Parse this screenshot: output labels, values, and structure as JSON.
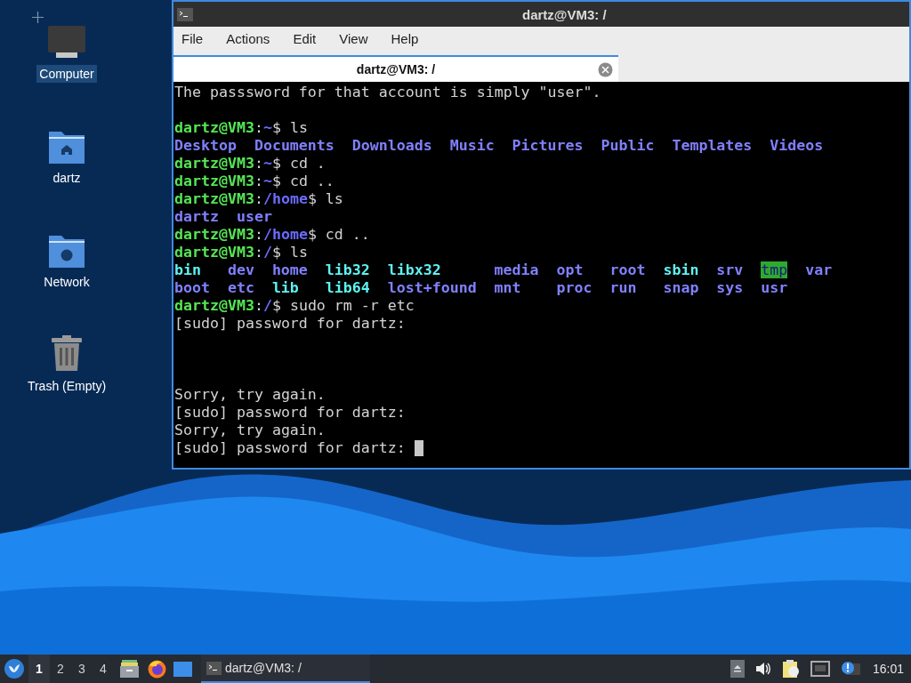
{
  "desktop_icons": [
    {
      "label": "Computer",
      "kind": "computer",
      "selected": true
    },
    {
      "label": "dartz",
      "kind": "home",
      "selected": false
    },
    {
      "label": "Network",
      "kind": "network",
      "selected": false
    },
    {
      "label": "Trash (Empty)",
      "kind": "trash",
      "selected": false
    }
  ],
  "window": {
    "title": "dartz@VM3: /",
    "menu": [
      "File",
      "Actions",
      "Edit",
      "View",
      "Help"
    ],
    "tabs": [
      {
        "label": "dartz@VM3: /",
        "selected": true
      }
    ],
    "terminal": {
      "lines": [
        {
          "kind": "text",
          "segments": [
            {
              "kind": "plain",
              "text": "The passsword for that account is simply \"user\"."
            }
          ]
        },
        {
          "kind": "blank"
        },
        {
          "kind": "text",
          "segments": [
            {
              "kind": "prompt",
              "text": "dartz@VM3"
            },
            {
              "kind": "plain",
              "text": ":"
            },
            {
              "kind": "path",
              "text": "~"
            },
            {
              "kind": "plain",
              "text": "$ ls"
            }
          ]
        },
        {
          "kind": "listing",
          "rows": [
            [
              {
                "kind": "dir",
                "text": "Desktop"
              },
              {
                "kind": "dir",
                "text": "Documents"
              },
              {
                "kind": "dir",
                "text": "Downloads"
              },
              {
                "kind": "dir",
                "text": "Music"
              },
              {
                "kind": "dir",
                "text": "Pictures"
              },
              {
                "kind": "dir",
                "text": "Public"
              },
              {
                "kind": "dir",
                "text": "Templates"
              },
              {
                "kind": "dir",
                "text": "Videos"
              }
            ]
          ]
        },
        {
          "kind": "text",
          "segments": [
            {
              "kind": "prompt",
              "text": "dartz@VM3"
            },
            {
              "kind": "plain",
              "text": ":"
            },
            {
              "kind": "path",
              "text": "~"
            },
            {
              "kind": "plain",
              "text": "$ cd ."
            }
          ]
        },
        {
          "kind": "text",
          "segments": [
            {
              "kind": "prompt",
              "text": "dartz@VM3"
            },
            {
              "kind": "plain",
              "text": ":"
            },
            {
              "kind": "path",
              "text": "~"
            },
            {
              "kind": "plain",
              "text": "$ cd .."
            }
          ]
        },
        {
          "kind": "text",
          "segments": [
            {
              "kind": "prompt",
              "text": "dartz@VM3"
            },
            {
              "kind": "plain",
              "text": ":"
            },
            {
              "kind": "path",
              "text": "/home"
            },
            {
              "kind": "plain",
              "text": "$ ls"
            }
          ]
        },
        {
          "kind": "listing",
          "rows": [
            [
              {
                "kind": "dir",
                "text": "dartz"
              },
              {
                "kind": "dir",
                "text": "user"
              }
            ]
          ]
        },
        {
          "kind": "text",
          "segments": [
            {
              "kind": "prompt",
              "text": "dartz@VM3"
            },
            {
              "kind": "plain",
              "text": ":"
            },
            {
              "kind": "path",
              "text": "/home"
            },
            {
              "kind": "plain",
              "text": "$ cd .."
            }
          ]
        },
        {
          "kind": "text",
          "segments": [
            {
              "kind": "prompt",
              "text": "dartz@VM3"
            },
            {
              "kind": "plain",
              "text": ":"
            },
            {
              "kind": "path",
              "text": "/"
            },
            {
              "kind": "plain",
              "text": "$ ls"
            }
          ]
        },
        {
          "kind": "listing",
          "rows": [
            [
              {
                "kind": "link",
                "text": "bin"
              },
              {
                "kind": "dir",
                "text": "dev"
              },
              {
                "kind": "dir",
                "text": "home"
              },
              {
                "kind": "link",
                "text": "lib32"
              },
              {
                "kind": "link",
                "text": "libx32"
              },
              {
                "kind": "dir",
                "text": "media"
              },
              {
                "kind": "dir",
                "text": "opt"
              },
              {
                "kind": "dir",
                "text": "root"
              },
              {
                "kind": "link",
                "text": "sbin"
              },
              {
                "kind": "dir",
                "text": "srv"
              },
              {
                "kind": "sticky",
                "text": "tmp"
              },
              {
                "kind": "dir",
                "text": "var"
              }
            ],
            [
              {
                "kind": "dir",
                "text": "boot"
              },
              {
                "kind": "dir",
                "text": "etc"
              },
              {
                "kind": "link",
                "text": "lib"
              },
              {
                "kind": "link",
                "text": "lib64"
              },
              {
                "kind": "dir",
                "text": "lost+found"
              },
              {
                "kind": "dir",
                "text": "mnt"
              },
              {
                "kind": "dir",
                "text": "proc"
              },
              {
                "kind": "dir",
                "text": "run"
              },
              {
                "kind": "dir",
                "text": "snap"
              },
              {
                "kind": "dir",
                "text": "sys"
              },
              {
                "kind": "dir",
                "text": "usr"
              }
            ]
          ]
        },
        {
          "kind": "text",
          "segments": [
            {
              "kind": "prompt",
              "text": "dartz@VM3"
            },
            {
              "kind": "plain",
              "text": ":"
            },
            {
              "kind": "path",
              "text": "/"
            },
            {
              "kind": "plain",
              "text": "$ sudo rm -r etc"
            }
          ]
        },
        {
          "kind": "text",
          "segments": [
            {
              "kind": "plain",
              "text": "[sudo] password for dartz:"
            }
          ]
        },
        {
          "kind": "blank"
        },
        {
          "kind": "blank"
        },
        {
          "kind": "blank"
        },
        {
          "kind": "text",
          "segments": [
            {
              "kind": "plain",
              "text": "Sorry, try again."
            }
          ]
        },
        {
          "kind": "text",
          "segments": [
            {
              "kind": "plain",
              "text": "[sudo] password for dartz:"
            }
          ]
        },
        {
          "kind": "text",
          "segments": [
            {
              "kind": "plain",
              "text": "Sorry, try again."
            }
          ]
        },
        {
          "kind": "text",
          "cursor": true,
          "segments": [
            {
              "kind": "plain",
              "text": "[sudo] password for dartz:"
            }
          ]
        }
      ]
    }
  },
  "taskbar": {
    "workspaces": [
      {
        "label": "1",
        "selected": true
      },
      {
        "label": "2",
        "selected": false
      },
      {
        "label": "3",
        "selected": false
      },
      {
        "label": "4",
        "selected": false
      }
    ],
    "tasks": [
      {
        "label": "dartz@VM3: /",
        "selected": true
      }
    ],
    "clock": "16:01"
  }
}
